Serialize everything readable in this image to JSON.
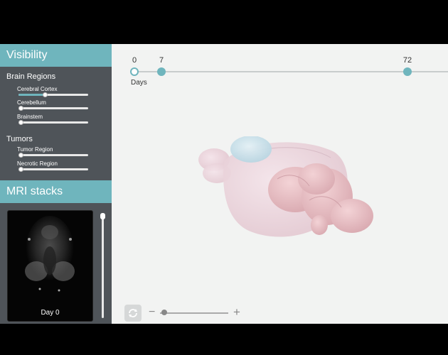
{
  "sidebar": {
    "visibility_title": "Visibility",
    "brain_regions_title": "Brain Regions",
    "brain_regions": [
      {
        "label": "Cerebral Cortex",
        "value": 0.38
      },
      {
        "label": "Cerebellum",
        "value": 0.0
      },
      {
        "label": "Brainstem",
        "value": 0.0
      }
    ],
    "tumors_title": "Tumors",
    "tumors": [
      {
        "label": "Tumor Region",
        "value": 0.0
      },
      {
        "label": "Necrotic Region",
        "value": 0.0
      }
    ],
    "mri_title": "MRI stacks",
    "mri_day_label": "Day 0",
    "mri_slice_position": 0.0
  },
  "timeline": {
    "ticks": [
      {
        "label": "0",
        "state": "selected"
      },
      {
        "label": "7",
        "state": "available"
      },
      {
        "label": "72",
        "state": "available"
      }
    ],
    "unit_label": "Days"
  },
  "viewer": {
    "zoom_minus": "−",
    "zoom_plus": "+",
    "zoom_level": 0.02
  },
  "colors": {
    "accent": "#6fb5bd",
    "sidebar_bg": "#4f5459",
    "main_bg": "#f2f3f2"
  },
  "icons": {
    "rotate": "rotate-icon"
  }
}
